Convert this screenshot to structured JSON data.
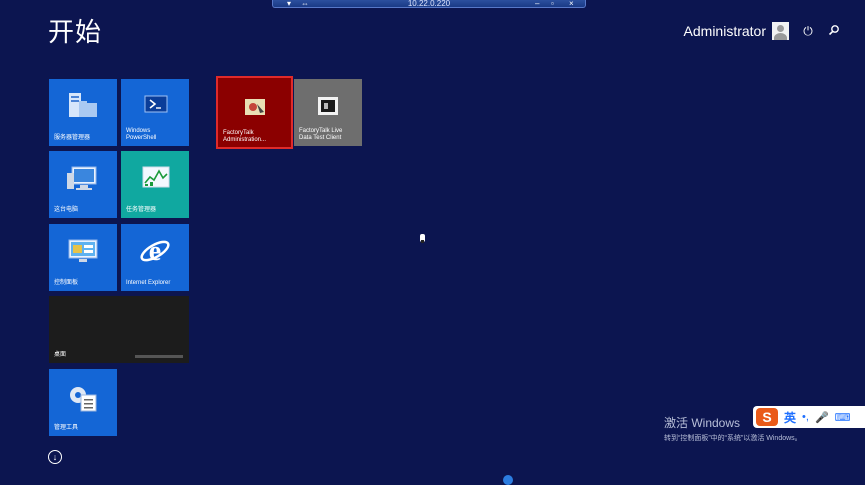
{
  "screen": {
    "title": "开始",
    "user": "Administrator"
  },
  "rdp_bar": {
    "host": "10.22.0.220",
    "controls": [
      "▾",
      "⇔",
      "–",
      "▫",
      "×"
    ]
  },
  "tiles": {
    "server_manager": "服务器管理器",
    "powershell": "Windows\nPowerShell",
    "factorytalk_admin": "FactoryTalk\nAdministration...",
    "factorytalk_live": "FactoryTalk Live\nData Test Client",
    "computer": "这台电脑",
    "task_manager": "任务管理器",
    "control_panel": "控制面板",
    "ie": "Internet Explorer",
    "desktop": "桌面",
    "admin_tools": "管理工具"
  },
  "activate": {
    "line1": "激活 Windows",
    "line2": "转到“控制面板”中的“系统”以激活 Windows。"
  },
  "ime": {
    "logo": "S",
    "lang": "英",
    "punct": "•,",
    "mic": "🎤",
    "keyboard": "⌨"
  },
  "colors": {
    "background": "#0c1550",
    "tile_blue": "#1466d6",
    "tile_teal": "#10a8a0",
    "tile_red": "#8b0000",
    "tile_gray": "#6e6e6e",
    "tile_dark": "#1c1c1c"
  }
}
